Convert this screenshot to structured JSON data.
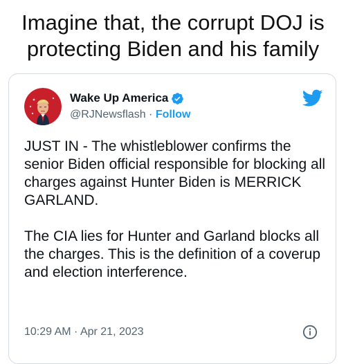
{
  "caption": {
    "line1": "Imagine that, the corrupt DOJ is",
    "line2": "protecting Biden and his family"
  },
  "tweet": {
    "author": {
      "display_name": "Wake Up America",
      "handle": "@RJNewsflash",
      "separator": " · ",
      "follow_label": "Follow",
      "verified": true
    },
    "body": {
      "paragraph1": "JUST IN - The whistleblower confirms the senior Biden official responsible for blocking all charges against Hunter Biden is MERRICK GARLAND.",
      "paragraph2": "The CIA lies for Hunter and Garland blocks all the charges. This is the definition of a coverup and election interference."
    },
    "timestamp": "10:29 AM · Apr 21, 2023"
  },
  "icons": {
    "verified": "verified-badge-icon",
    "brand": "twitter-bird-icon",
    "info": "info-icon",
    "avatar": "profile-avatar"
  },
  "colors": {
    "accent": "#1d9bf0",
    "text": "#0f1419",
    "muted": "#536471",
    "border": "#d6dbdf",
    "avatar_bg": "#c8202a"
  }
}
